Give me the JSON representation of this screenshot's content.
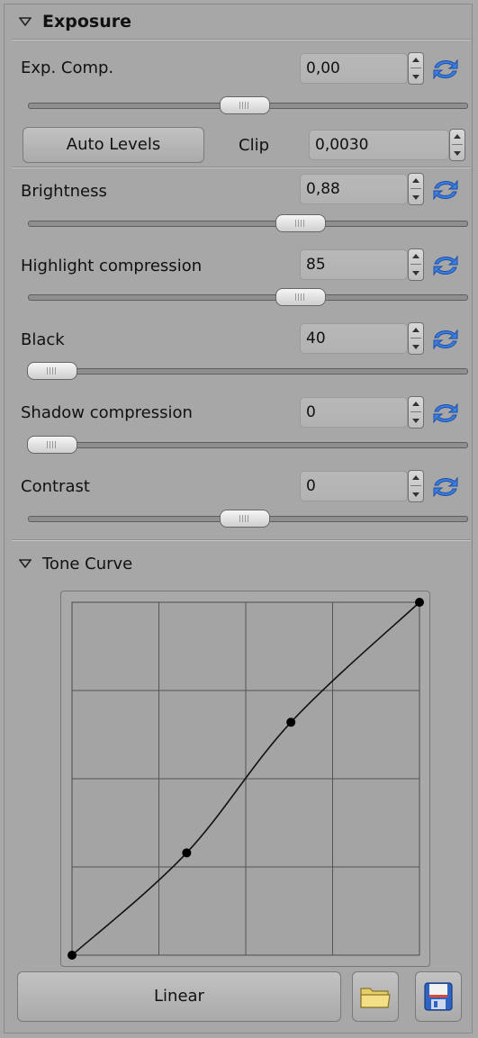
{
  "exposure": {
    "title": "Exposure",
    "exp_comp": {
      "label": "Exp. Comp.",
      "value": "0,00",
      "slider_fraction": 0.5
    },
    "auto_levels_label": "Auto Levels",
    "clip": {
      "label": "Clip",
      "value": "0,0030"
    },
    "brightness": {
      "label": "Brightness",
      "value": "0,88",
      "slider_fraction": 0.63
    },
    "highlight_compression": {
      "label": "Highlight compression",
      "value": "85",
      "slider_fraction": 0.63
    },
    "black": {
      "label": "Black",
      "value": "40",
      "slider_fraction": 0.0
    },
    "shadow_compression": {
      "label": "Shadow compression",
      "value": "0",
      "slider_fraction": 0.0
    },
    "contrast": {
      "label": "Contrast",
      "value": "0",
      "slider_fraction": 0.5
    }
  },
  "tone_curve": {
    "title": "Tone Curve",
    "points": [
      [
        0,
        0
      ],
      [
        0.33,
        0.29
      ],
      [
        0.63,
        0.66
      ],
      [
        1,
        1
      ]
    ],
    "grid_divisions": 4,
    "linear_label": "Linear",
    "icons": {
      "open": "folder-icon",
      "save": "save-disk-icon"
    }
  },
  "colors": {
    "reset_icon": "#2f6fd6",
    "panel": "#a7a7a7"
  }
}
